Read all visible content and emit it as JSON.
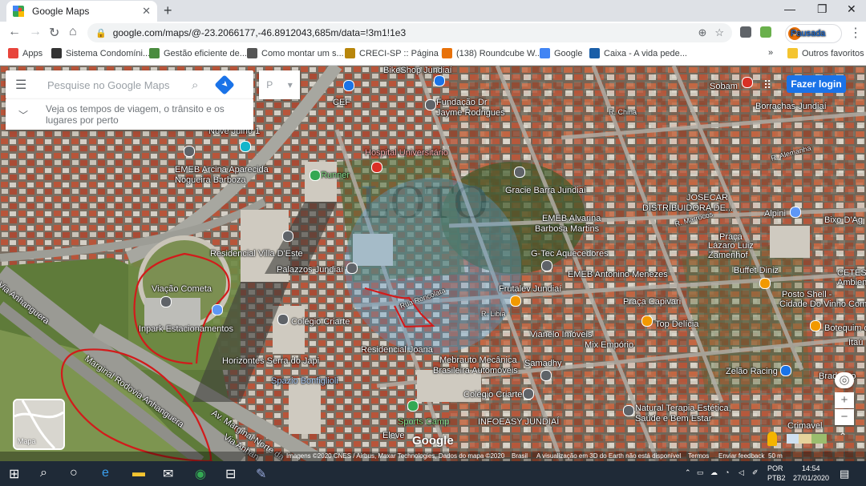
{
  "browser": {
    "tab_title": "Google Maps",
    "tab_close": "✕",
    "new_tab": "+",
    "window_controls": [
      "—",
      "❐",
      "✕"
    ],
    "url": "google.com/maps/@-23.2066177,-46.8912043,685m/data=!3m1!1e3",
    "profile_initial": "O",
    "profile_label": "Pausada"
  },
  "bookmarks": [
    {
      "label": "Apps",
      "color": "#e8453c"
    },
    {
      "label": "Sistema Condomíni...",
      "color": "#333333"
    },
    {
      "label": "Gestão eficiente de...",
      "color": "#4a8c3f"
    },
    {
      "label": "Como montar um s...",
      "color": "#555555"
    },
    {
      "label": "CRECI-SP :: Página I...",
      "color": "#b8860b"
    },
    {
      "label": "(138) Roundcube W...",
      "color": "#e8710a"
    },
    {
      "label": "Google",
      "color": "#4285f4"
    },
    {
      "label": "Caixa - A vida pede...",
      "color": "#1a5ea8"
    }
  ],
  "bookmarks_more": "»",
  "bookmarks_other": "Outros favoritos",
  "maps": {
    "search_placeholder": "Pesquise no Google Maps",
    "hint": "Veja os tempos de viagem, o trânsito e os lugares por perto",
    "login_button": "Fazer login",
    "minimap_label": "Mapa",
    "google_logo": "Google",
    "zoom_in": "+",
    "zoom_out": "−",
    "attribution": [
      "Imagens ©2020 CNES / Airbus, Maxar Technologies, Dados do mapa ©2020",
      "Brasil",
      "A visualização em 3D do Earth não está disponível",
      "Termos",
      "Enviar feedback",
      "50 m"
    ],
    "labels": [
      {
        "t": "BikeShop Jundiaí",
        "c": ""
      },
      {
        "t": "CEF",
        "c": ""
      },
      {
        "t": "Fundação Dr",
        "c": ""
      },
      {
        "t": "Jayme Rodrigues",
        "c": ""
      },
      {
        "t": "Nove Julho 1",
        "c": ""
      },
      {
        "t": "Hospital Universitário",
        "c": "red"
      },
      {
        "t": "EMEB Arcina Aparecida",
        "c": ""
      },
      {
        "t": "Nogueira Barboza",
        "c": ""
      },
      {
        "t": "Runner",
        "c": "green"
      },
      {
        "t": "Gracie Barra Jundiaí",
        "c": ""
      },
      {
        "t": "EMEB Alvarina",
        "c": ""
      },
      {
        "t": "Barbosa Martins",
        "c": ""
      },
      {
        "t": "Residencial Villa D'Este",
        "c": ""
      },
      {
        "t": "Palazzos Jundiaí",
        "c": ""
      },
      {
        "t": "G-Tec Aquecedores",
        "c": ""
      },
      {
        "t": "EMEB Antonino Menezes",
        "c": ""
      },
      {
        "t": "Viação Cometa",
        "c": ""
      },
      {
        "t": "Inpark Estacionamentos",
        "c": ""
      },
      {
        "t": "Frutalev Jundiaí",
        "c": ""
      },
      {
        "t": "Colégio Criarte",
        "c": ""
      },
      {
        "t": "Vianelo Imóveis",
        "c": ""
      },
      {
        "t": "Praça Capivari",
        "c": ""
      },
      {
        "t": "Top Delícia",
        "c": ""
      },
      {
        "t": "Residencial Joana",
        "c": ""
      },
      {
        "t": "Mix Empório",
        "c": ""
      },
      {
        "t": "Horizontes Serra do Japi",
        "c": ""
      },
      {
        "t": "Mebrauto Mecânica",
        "c": ""
      },
      {
        "t": "Brasileira Automóveis",
        "c": ""
      },
      {
        "t": "Samadhy",
        "c": ""
      },
      {
        "t": "Spazio Bonfiglioli",
        "c": "blue"
      },
      {
        "t": "Colégio Criarte",
        "c": ""
      },
      {
        "t": "Sports Camp",
        "c": "green"
      },
      {
        "t": "INFOEASY JUNDIAÍ",
        "c": ""
      },
      {
        "t": "Eleve",
        "c": ""
      },
      {
        "t": "Natural Terapia Estética,",
        "c": ""
      },
      {
        "t": "Saúde e Bem Estar",
        "c": ""
      },
      {
        "t": "Zelão Racing",
        "c": ""
      },
      {
        "t": "Bradesco",
        "c": ""
      },
      {
        "t": "Crimavel",
        "c": ""
      },
      {
        "t": "Sobam",
        "c": ""
      },
      {
        "t": "Borrachas Jundiaí",
        "c": ""
      },
      {
        "t": "JOSECAR",
        "c": ""
      },
      {
        "t": "DISTRIBUIDORA DE...",
        "c": ""
      },
      {
        "t": "Alpini",
        "c": ""
      },
      {
        "t": "Bixo D'Ag",
        "c": ""
      },
      {
        "t": "Praça",
        "c": ""
      },
      {
        "t": "Lázaro Luiz",
        "c": ""
      },
      {
        "t": "Zamenhof",
        "c": ""
      },
      {
        "t": "Buffet Diniz",
        "c": ""
      },
      {
        "t": "CETESB",
        "c": ""
      },
      {
        "t": "Ambien",
        "c": ""
      },
      {
        "t": "Posto Shell -",
        "c": ""
      },
      {
        "t": "Cidade Do Vinho Com",
        "c": ""
      },
      {
        "t": "Botequim d",
        "c": ""
      },
      {
        "t": "Itaú",
        "c": ""
      },
      {
        "t": "Via Anhanguera",
        "c": ""
      },
      {
        "t": "Marginal Rodovia Anhanguera",
        "c": ""
      },
      {
        "t": "Av. Marginal Norte da",
        "c": ""
      },
      {
        "t": "Via Anhan",
        "c": ""
      },
      {
        "t": "R. Libia",
        "c": ""
      },
      {
        "t": "Rua Roncolata",
        "c": ""
      },
      {
        "t": "R. Marrocos",
        "c": ""
      },
      {
        "t": "R. Alemanha",
        "c": ""
      },
      {
        "t": "R. China",
        "c": ""
      }
    ]
  },
  "taskbar": {
    "lang1": "POR",
    "lang2": "PTB2",
    "time": "14:54",
    "date": "27/01/2020"
  }
}
